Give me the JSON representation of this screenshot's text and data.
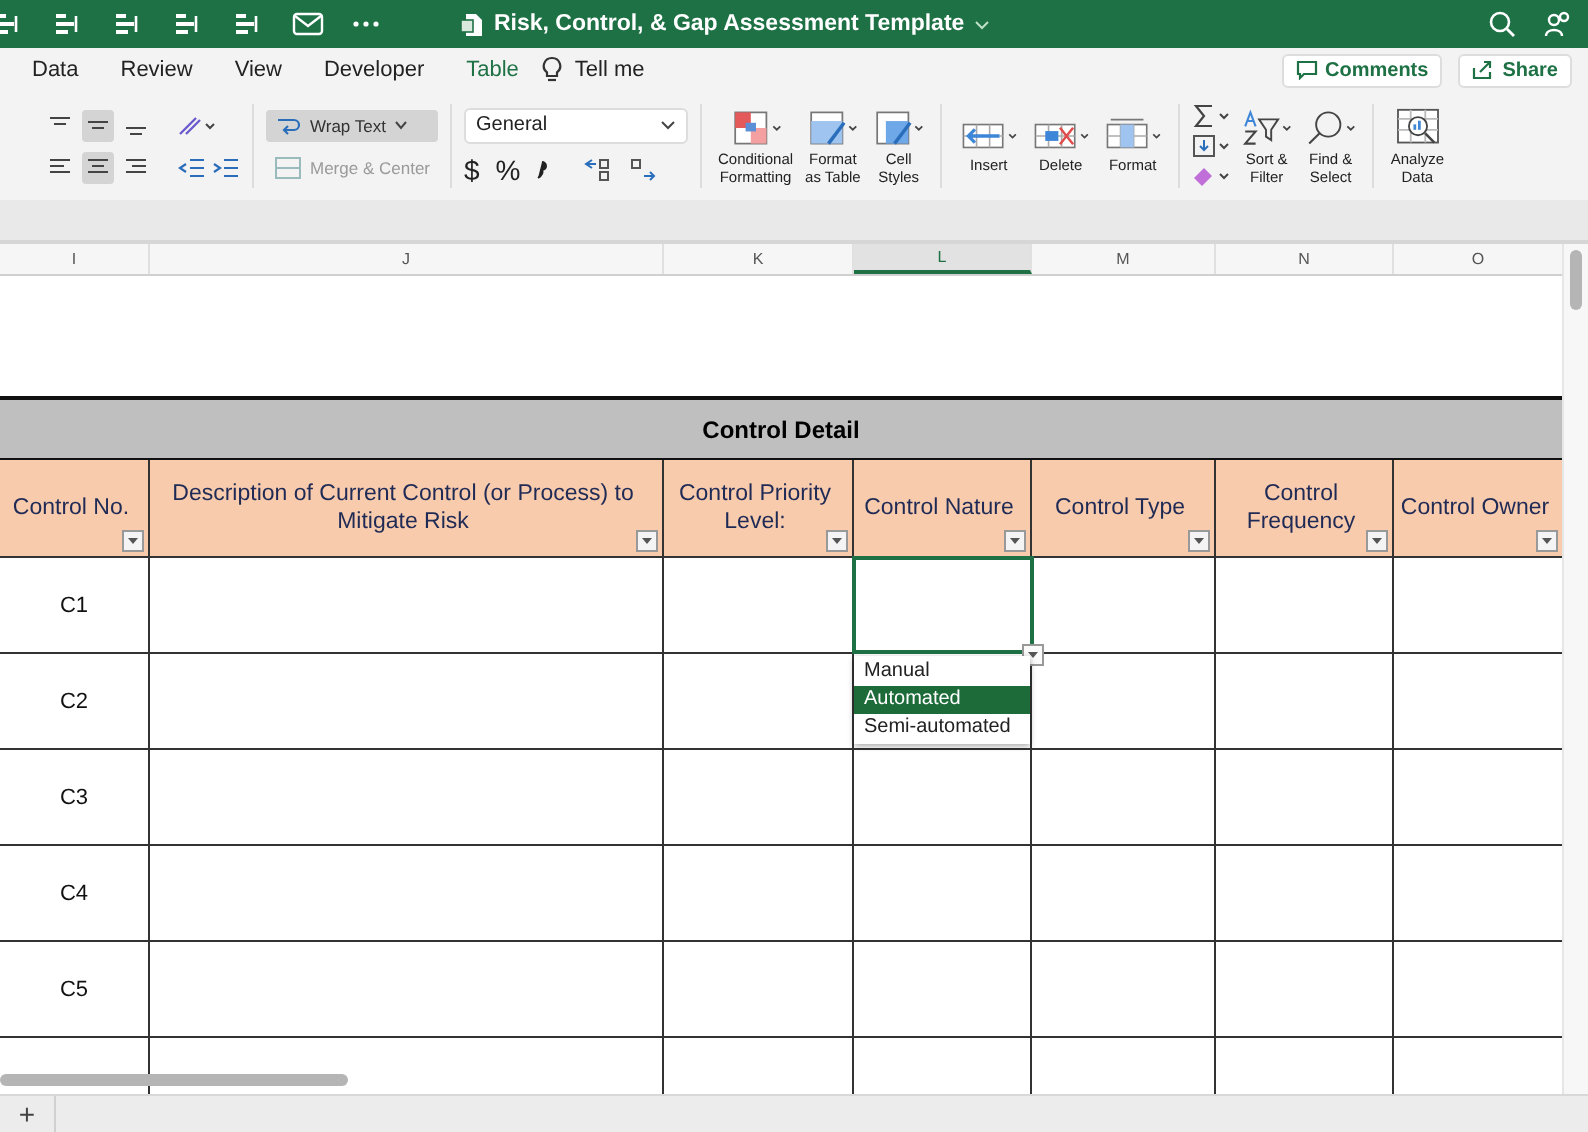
{
  "title_bar": {
    "title": "Risk, Control, & Gap Assessment Template"
  },
  "menu_tabs": [
    {
      "label": "Data",
      "kind": "normal"
    },
    {
      "label": "Review",
      "kind": "normal"
    },
    {
      "label": "View",
      "kind": "normal"
    },
    {
      "label": "Developer",
      "kind": "normal"
    },
    {
      "label": "Table",
      "kind": "contextual"
    }
  ],
  "tell_me": "Tell me",
  "comments_button": "Comments",
  "share_button": "Share",
  "ribbon": {
    "vertical_align": [
      {
        "selected": false
      },
      {
        "selected": true
      },
      {
        "selected": false
      }
    ],
    "horizontal_align": [
      {
        "selected": false
      },
      {
        "selected": true
      },
      {
        "selected": false
      }
    ],
    "wrap_text": {
      "label": "Wrap Text",
      "on": true
    },
    "merge_center": {
      "label": "Merge & Center",
      "disabled": true
    },
    "number_format": {
      "value": "General"
    },
    "number_symbols": [
      "$",
      "%"
    ],
    "style_buttons": [
      {
        "label": "Conditional\nFormatting",
        "kind": "conditional"
      },
      {
        "label": "Format\nas Table",
        "kind": "table"
      },
      {
        "label": "Cell\nStyles",
        "kind": "styles"
      }
    ],
    "cell_buttons": [
      {
        "label": "Insert",
        "kind": "insert"
      },
      {
        "label": "Delete",
        "kind": "delete"
      },
      {
        "label": "Format",
        "kind": "format"
      }
    ],
    "edit_buttons": [
      {
        "label": "Sort &\nFilter",
        "kind": "sort"
      },
      {
        "label": "Find &\nSelect",
        "kind": "find"
      }
    ],
    "analyze_button": {
      "label": "Analyze\nData"
    }
  },
  "sheet": {
    "column_letters": [
      {
        "label": "I",
        "selected": false
      },
      {
        "label": "J",
        "selected": false
      },
      {
        "label": "K",
        "selected": false
      },
      {
        "label": "L",
        "selected": true
      },
      {
        "label": "M",
        "selected": false
      },
      {
        "label": "N",
        "selected": false
      },
      {
        "label": "O",
        "selected": false
      }
    ],
    "section_title": "Control Detail",
    "table_headers": [
      "Control No.",
      "Description of Current Control (or Process) to Mitigate Risk",
      "Control Priority Level:",
      "Control Nature",
      "Control Type",
      "Control Frequency",
      "Control Owner"
    ],
    "rows": [
      {
        "label": "C1",
        "dropdown": {
          "options": [
            {
              "label": "Manual",
              "selected": false
            },
            {
              "label": "Automated",
              "selected": true
            },
            {
              "label": "Semi-automated",
              "selected": false
            }
          ]
        }
      },
      {
        "label": "C2"
      },
      {
        "label": "C3"
      },
      {
        "label": "C4"
      },
      {
        "label": "C5"
      }
    ]
  },
  "sheet_bar": {
    "add_button": "+"
  }
}
